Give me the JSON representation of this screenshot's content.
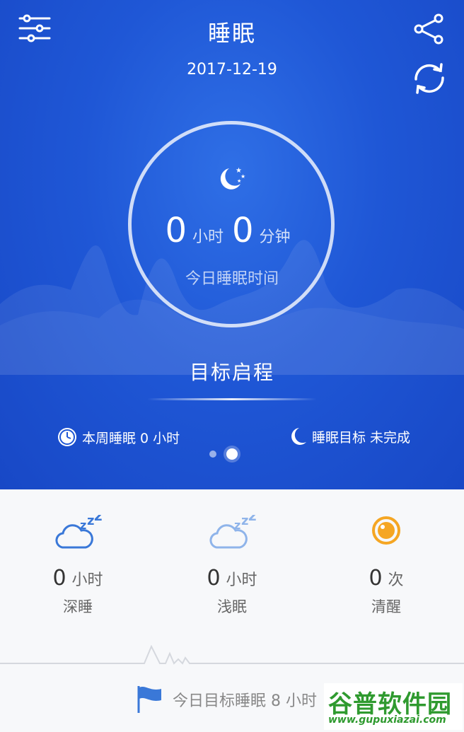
{
  "header": {
    "title": "睡眠",
    "date": "2017-12-19",
    "icons": [
      "settings-sliders-icon",
      "share-icon",
      "sync-icon"
    ]
  },
  "summary": {
    "hours": "0",
    "hours_unit": "小时",
    "minutes": "0",
    "minutes_unit": "分钟",
    "label": "今日睡眠时间"
  },
  "goal": {
    "title": "目标启程",
    "weekly_label": "本周睡眠 0 小时",
    "target_label": "睡眠目标 未完成"
  },
  "pager": {
    "count": 2,
    "active": 2
  },
  "stats": [
    {
      "icon": "deep-sleep-cloud-icon",
      "value": "0",
      "unit": "小时",
      "label": "深睡"
    },
    {
      "icon": "light-sleep-cloud-icon",
      "value": "0",
      "unit": "小时",
      "label": "浅眠"
    },
    {
      "icon": "awake-eye-icon",
      "value": "0",
      "unit": "次",
      "label": "清醒"
    }
  ],
  "footer": {
    "text": "今日目标睡眠 8 小时"
  },
  "watermark": {
    "brand": "谷普软件园",
    "url": "www.gupuxiazai.com"
  },
  "colors": {
    "hero": "#1f57d6",
    "accent_orange": "#f5a623",
    "icon_blue": "#3a78d8"
  }
}
